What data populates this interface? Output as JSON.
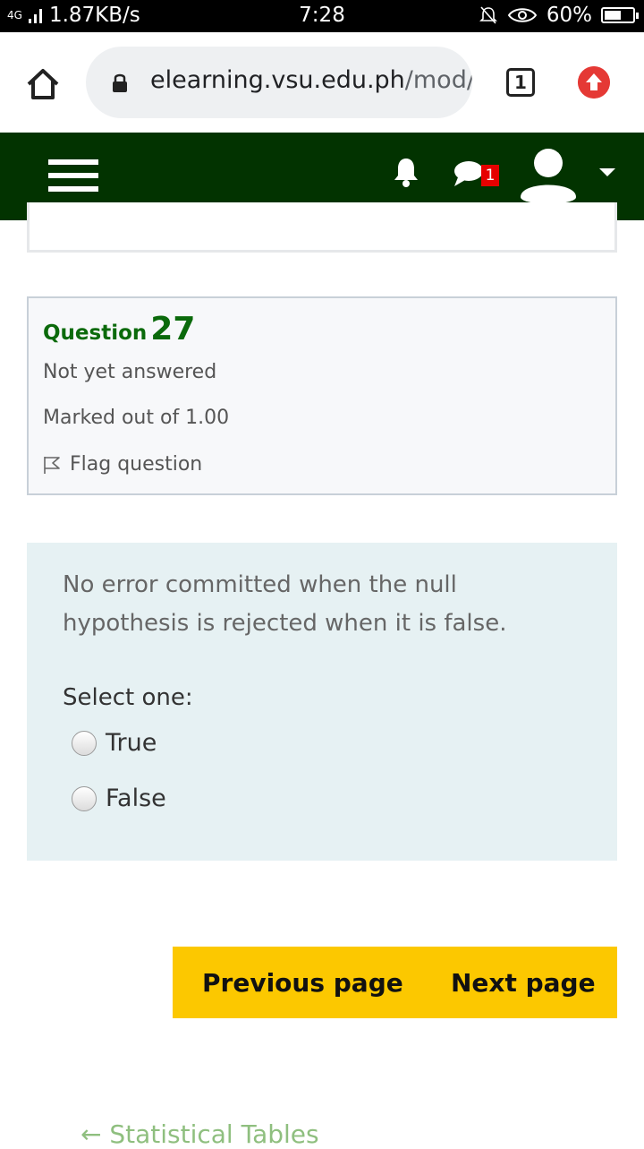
{
  "status_bar": {
    "network": "4G",
    "speed": "1.87KB/s",
    "time": "7:28",
    "battery": "60%",
    "battery_level": 0.6
  },
  "browser": {
    "url_host": "elearning.vsu.edu.ph",
    "url_path": "/mod/c",
    "tab_count": "1"
  },
  "navbar": {
    "messages_badge": "1",
    "colors": {
      "background": "#023300",
      "badge": "#e60000"
    }
  },
  "question": {
    "label": "Question",
    "number": "27",
    "state": "Not yet answered",
    "grade": "Marked out of 1.00",
    "flag_label": "Flag question",
    "text": "No error committed when the null hypothesis is rejected when it is false.",
    "prompt": "Select one:",
    "options": [
      "True",
      "False"
    ]
  },
  "pagination": {
    "previous_label": "Previous page",
    "next_label": "Next page",
    "color": "#fcc800"
  },
  "footer": {
    "link_text": "← Statistical Tables"
  }
}
